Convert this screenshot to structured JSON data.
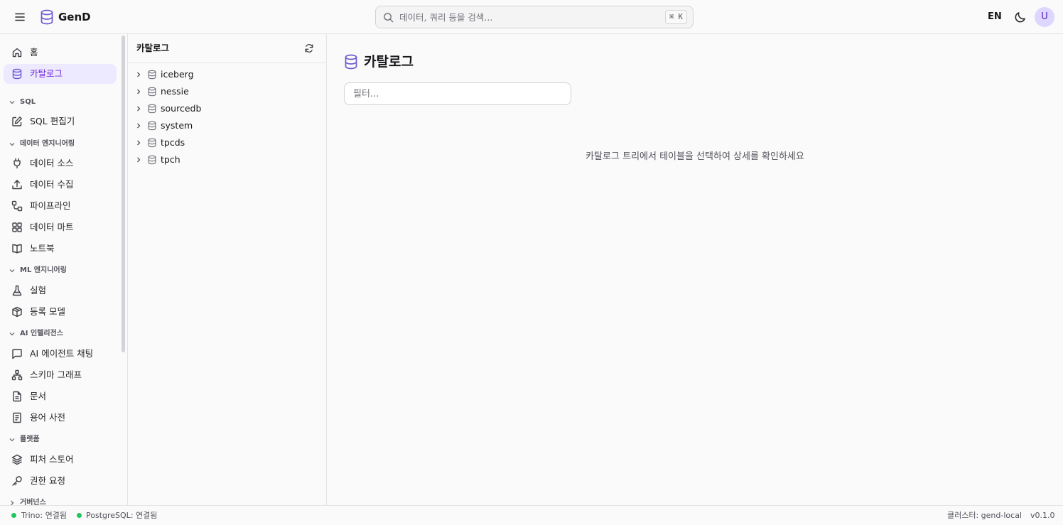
{
  "header": {
    "brand": "GenD",
    "search_placeholder": "데이터, 쿼리 등을 검색...",
    "search_shortcut": "⌘ K",
    "lang": "EN",
    "avatar": "U",
    "accent": "#6d5bd0"
  },
  "sidebar": {
    "items": [
      {
        "label": "홈",
        "icon": "home-icon"
      },
      {
        "label": "카탈로그",
        "icon": "database-icon",
        "active": true
      }
    ],
    "sections": [
      {
        "title": "SQL",
        "items": [
          {
            "label": "SQL 편집기",
            "icon": "edit-icon"
          }
        ]
      },
      {
        "title": "데이터 엔지니어링",
        "items": [
          {
            "label": "데이터 소스",
            "icon": "plug-icon"
          },
          {
            "label": "데이터 수집",
            "icon": "upload-icon"
          },
          {
            "label": "파이프라인",
            "icon": "workflow-icon"
          },
          {
            "label": "데이터 마트",
            "icon": "grid-icon"
          },
          {
            "label": "노트북",
            "icon": "book-icon"
          }
        ]
      },
      {
        "title": "ML 엔지니어링",
        "items": [
          {
            "label": "실험",
            "icon": "flask-icon"
          },
          {
            "label": "등록 모델",
            "icon": "box-icon"
          }
        ]
      },
      {
        "title": "AI 인텔리전스",
        "items": [
          {
            "label": "AI 에이전트 채팅",
            "icon": "chat-icon"
          },
          {
            "label": "스키마 그래프",
            "icon": "network-icon"
          },
          {
            "label": "문서",
            "icon": "file-icon"
          },
          {
            "label": "용어 사전",
            "icon": "dictionary-icon"
          }
        ]
      },
      {
        "title": "플랫폼",
        "items": [
          {
            "label": "피처 스토어",
            "icon": "layers-icon"
          },
          {
            "label": "권한 요청",
            "icon": "key-icon"
          }
        ]
      },
      {
        "title": "거버넌스",
        "items": []
      }
    ]
  },
  "tree": {
    "title": "카탈로그",
    "catalogs": [
      "iceberg",
      "nessie",
      "sourcedb",
      "system",
      "tpcds",
      "tpch"
    ]
  },
  "main": {
    "title": "카탈로그",
    "filter_placeholder": "필터...",
    "empty_message": "카탈로그 트리에서 테이블을 선택하여 상세를 확인하세요"
  },
  "status": {
    "trino": "Trino: 연결됨",
    "postgres": "PostgreSQL: 연결됨",
    "cluster": "클러스터: gend-local",
    "version": "v0.1.0",
    "ok_color": "#22c55e"
  }
}
